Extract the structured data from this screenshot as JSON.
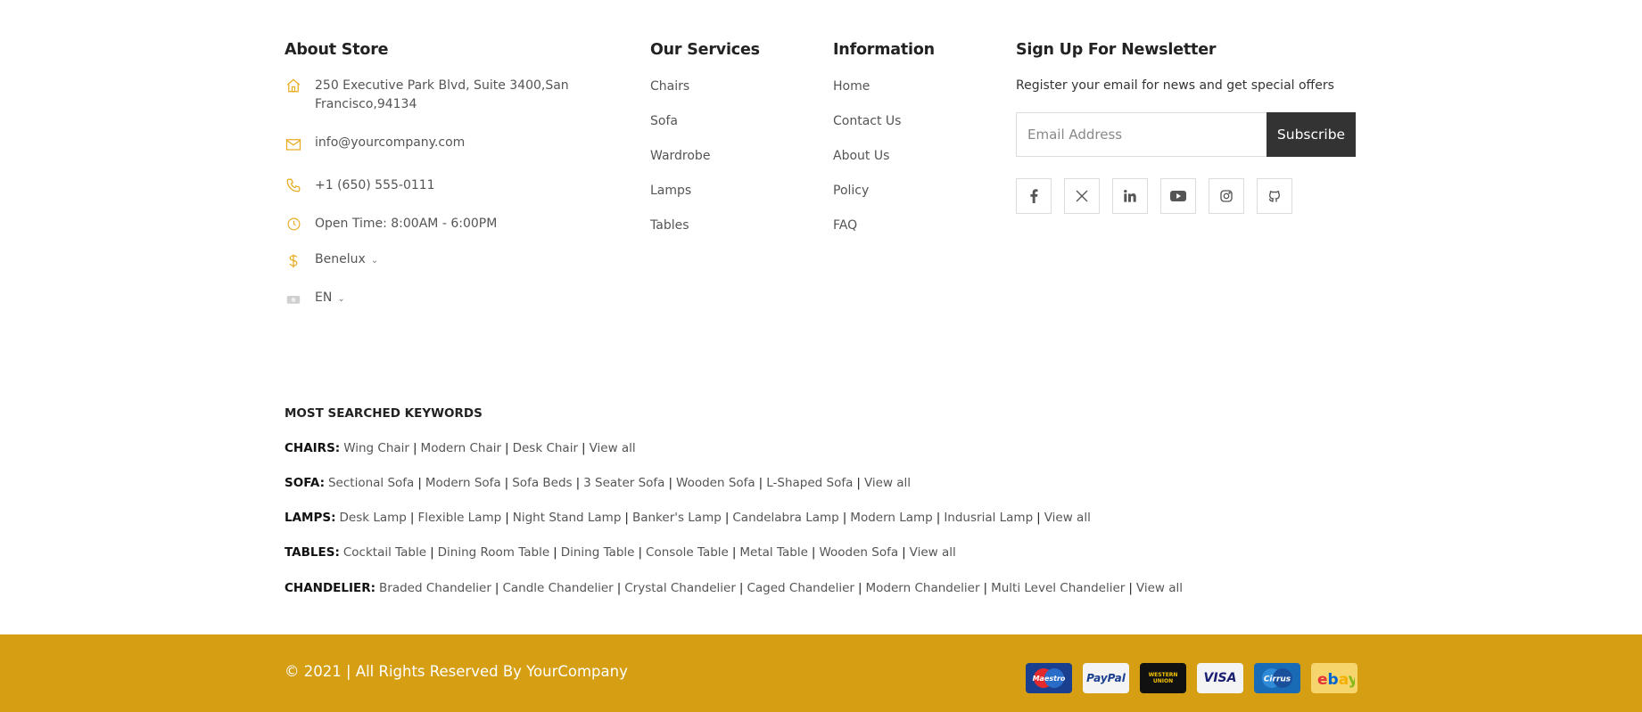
{
  "about": {
    "title": "About Store",
    "address_line1": "250 Executive Park Blvd, Suite 3400,San",
    "address_line2": "Francisco,94134",
    "email": "info@yourcompany.com",
    "phone": "+1 (650) 555-0111",
    "hours": "Open Time: 8:00AM - 6:00PM",
    "currency": "Benelux",
    "language": "EN",
    "accent_color": "#e8a91b"
  },
  "services": {
    "title": "Our Services",
    "items": [
      "Chairs",
      "Sofa",
      "Wardrobe",
      "Lamps",
      "Tables"
    ]
  },
  "information": {
    "title": "Information",
    "items": [
      "Home",
      "Contact Us",
      "About Us",
      "Policy",
      "FAQ"
    ]
  },
  "newsletter": {
    "title": "Sign Up For Newsletter",
    "description": "Register your email for news and get special offers",
    "email_placeholder": "Email Address",
    "subscribe_label": "Subscribe",
    "socials": [
      "facebook-icon",
      "x-twitter-icon",
      "linkedin-icon",
      "youtube-icon",
      "instagram-icon",
      "github-icon"
    ]
  },
  "keywords": {
    "title": "MOST SEARCHED KEYWORDS",
    "rows": [
      {
        "category": "CHAIRS:",
        "links": [
          "Wing Chair",
          "Modern Chair",
          "Desk Chair",
          "View all"
        ]
      },
      {
        "category": "SOFA:",
        "links": [
          "Sectional Sofa",
          "Modern Sofa",
          "Sofa Beds",
          "3 Seater Sofa",
          "Wooden Sofa",
          "L-Shaped Sofa",
          "View all"
        ]
      },
      {
        "category": "LAMPS:",
        "links": [
          "Desk Lamp",
          "Flexible Lamp",
          "Night Stand Lamp",
          "Banker's Lamp",
          "Candelabra Lamp",
          "Modern Lamp",
          "Indusrial Lamp",
          "View all"
        ]
      },
      {
        "category": "TABLES:",
        "links": [
          "Cocktail Table",
          "Dining Room Table",
          "Dining Table",
          "Console Table",
          "Metal Table",
          "Wooden Sofa",
          "View all"
        ]
      },
      {
        "category": "CHANDELIER:",
        "links": [
          "Braded Chandelier",
          "Candle Chandelier",
          "Crystal Chandelier",
          "Caged Chandelier",
          "Modern Chandelier",
          "Multi Level Chandelier",
          "View all"
        ]
      }
    ]
  },
  "footer": {
    "copyright": "© 2021 | All Rights Reserved By YourCompany",
    "bar_color": "#d69e13",
    "payments": [
      {
        "name": "maestro-icon",
        "label": "Maestro"
      },
      {
        "name": "paypal-icon",
        "label": "PayPal"
      },
      {
        "name": "western-union-icon",
        "label": "WESTERN UNION"
      },
      {
        "name": "visa-icon",
        "label": "VISA"
      },
      {
        "name": "cirrus-icon",
        "label": "Cirrus"
      },
      {
        "name": "ebay-icon",
        "label": "ebay"
      }
    ]
  }
}
